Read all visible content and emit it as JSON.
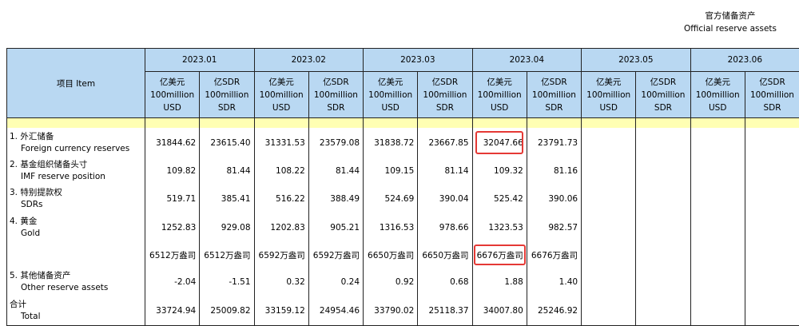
{
  "title": {
    "cn": "官方储备资产",
    "en": "Official reserve assets"
  },
  "header": {
    "item_label": "项目 Item",
    "periods": [
      "2023.01",
      "2023.02",
      "2023.03",
      "2023.04",
      "2023.05",
      "2023.06"
    ],
    "unit_usd": {
      "cn": "亿美元",
      "en1": "100million",
      "en2": "USD"
    },
    "unit_sdr": {
      "cn": "亿SDR",
      "en1": "100million",
      "en2": "SDR"
    }
  },
  "rows": [
    {
      "cn": "1. 外汇储备",
      "en": "Foreign currency reserves",
      "values": [
        "31844.62",
        "23615.40",
        "31331.53",
        "23579.08",
        "31838.72",
        "23667.85",
        "32047.66",
        "23791.73",
        "",
        "",
        "",
        ""
      ]
    },
    {
      "cn": "2. 基金组织储备头寸",
      "en": "IMF reserve position",
      "values": [
        "109.82",
        "81.44",
        "108.22",
        "81.44",
        "109.15",
        "81.14",
        "109.32",
        "81.16",
        "",
        "",
        "",
        ""
      ]
    },
    {
      "cn": "3. 特别提款权",
      "en": "SDRs",
      "values": [
        "519.71",
        "385.41",
        "516.22",
        "388.49",
        "524.69",
        "390.04",
        "525.42",
        "390.06",
        "",
        "",
        "",
        ""
      ]
    },
    {
      "cn": "4. 黄金",
      "en": "Gold",
      "values": [
        "1252.83",
        "929.08",
        "1202.83",
        "905.21",
        "1316.53",
        "978.66",
        "1323.53",
        "982.57",
        "",
        "",
        "",
        ""
      ]
    },
    {
      "cn": "",
      "en": "",
      "values": [
        "6512万盎司",
        "6512万盎司",
        "6592万盎司",
        "6592万盎司",
        "6650万盎司",
        "6650万盎司",
        "6676万盎司",
        "6676万盎司",
        "",
        "",
        "",
        ""
      ]
    },
    {
      "cn": "5. 其他储备资产",
      "en": "Other reserve assets",
      "values": [
        "-2.04",
        "-1.51",
        "0.32",
        "0.24",
        "0.92",
        "0.68",
        "1.88",
        "1.40",
        "",
        "",
        "",
        ""
      ]
    },
    {
      "cn": "合计",
      "en": "Total",
      "values": [
        "33724.94",
        "25009.82",
        "33159.12",
        "24954.46",
        "33790.02",
        "25118.37",
        "34007.80",
        "25246.92",
        "",
        "",
        "",
        ""
      ]
    }
  ],
  "highlight_color": "#e53935",
  "header_color": "#b9d8f2",
  "spacer_color": "#ffffb3"
}
